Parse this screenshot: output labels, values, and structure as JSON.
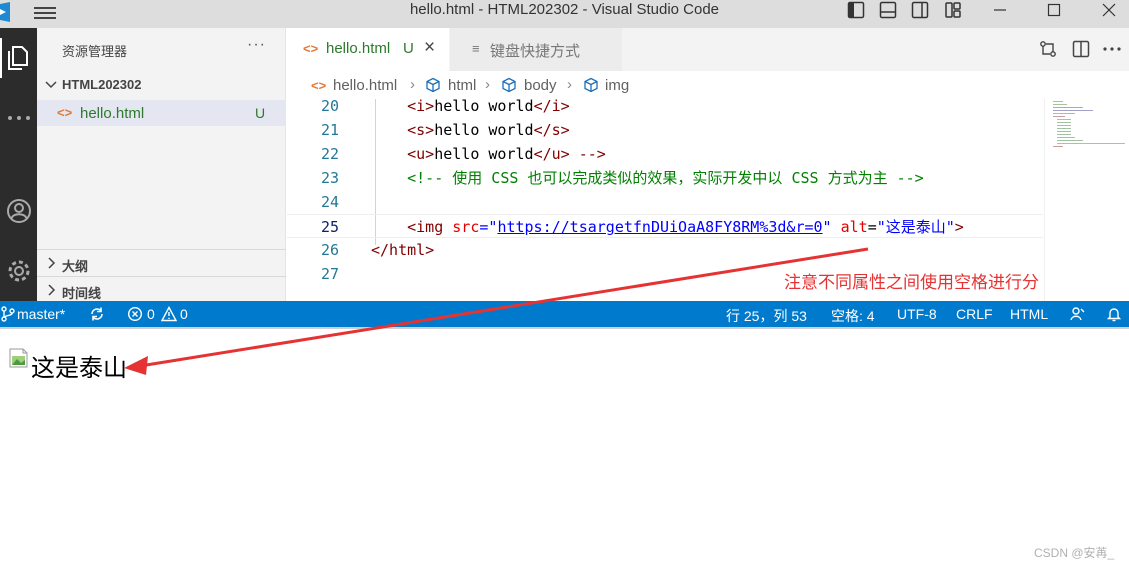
{
  "window": {
    "title": "hello.html - HTML202302 - Visual Studio Code"
  },
  "sidebar": {
    "title": "资源管理器",
    "more": "···",
    "folder": "HTML202302",
    "file": {
      "icon": "<>",
      "name": "hello.html",
      "badge": "U"
    },
    "sections": [
      "大纲",
      "时间线"
    ]
  },
  "tabs": [
    {
      "icon": "<>",
      "label": "hello.html",
      "badge": "U",
      "close": "×"
    },
    {
      "icon": "≡",
      "label": "键盘快捷方式"
    }
  ],
  "breadcrumb": [
    "hello.html",
    "html",
    "body",
    "img"
  ],
  "editor": {
    "lines": [
      {
        "num": "20",
        "indent": "    ",
        "tokens": [
          {
            "t": "<i>",
            "c": "tag"
          },
          {
            "t": "hello world",
            "c": "text"
          },
          {
            "t": "</i>",
            "c": "tag"
          }
        ]
      },
      {
        "num": "21",
        "indent": "    ",
        "tokens": [
          {
            "t": "<s>",
            "c": "tag"
          },
          {
            "t": "hello world",
            "c": "text"
          },
          {
            "t": "</s>",
            "c": "tag"
          }
        ]
      },
      {
        "num": "22",
        "indent": "    ",
        "tokens": [
          {
            "t": "<u>",
            "c": "tag"
          },
          {
            "t": "hello world",
            "c": "text"
          },
          {
            "t": "</u> -->",
            "c": "tag"
          }
        ]
      },
      {
        "num": "23",
        "indent": "    ",
        "tokens": [
          {
            "t": "<!-- 使用 CSS 也可以完成类似的效果，实际开发中以 CSS 方式为主 -->",
            "c": "comment"
          }
        ]
      },
      {
        "num": "24",
        "indent": "",
        "tokens": []
      },
      {
        "num": "25",
        "indent": "    ",
        "current": true,
        "tokens": [
          {
            "t": "<img ",
            "c": "tag"
          },
          {
            "t": "src",
            "c": "attr"
          },
          {
            "t": "=\"",
            "c": "val"
          },
          {
            "t": "https://tsargetfnDUiOaA8FY8RM%3d&r=0",
            "c": "link"
          },
          {
            "t": "\" ",
            "c": "val"
          },
          {
            "t": "alt",
            "c": "attr"
          },
          {
            "t": "=",
            "c": "punct"
          },
          {
            "t": "\"这是泰山\"",
            "c": "val"
          },
          {
            "t": ">",
            "c": "tag"
          }
        ]
      },
      {
        "num": "26",
        "indent": "",
        "tokens": [
          {
            "t": "</html>",
            "c": "tag"
          }
        ]
      },
      {
        "num": "27",
        "indent": "",
        "tokens": []
      }
    ]
  },
  "statusbar": {
    "branch": "master*",
    "errors": "0",
    "warnings": "0",
    "position": "行 25，列 53",
    "spaces": "空格: 4",
    "encoding": "UTF-8",
    "eol": "CRLF",
    "language": "HTML"
  },
  "preview": {
    "alt_text": "这是泰山"
  },
  "annotation": "注意不同属性之间使用空格进行分",
  "watermark": "CSDN @安苒_",
  "colors": {
    "statusbar": "#007acc",
    "annotation": "#e53333",
    "activitybar": "#2c2c2c"
  }
}
